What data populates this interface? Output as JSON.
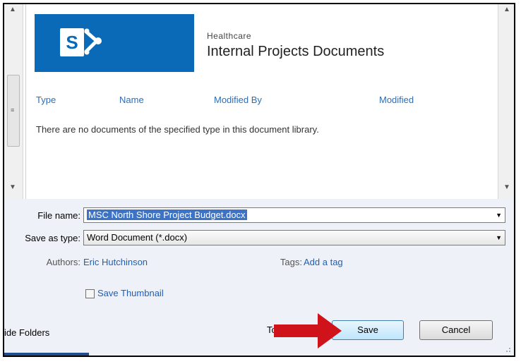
{
  "site": {
    "subtitle": "Healthcare",
    "title": "Internal Projects Documents",
    "logo_letter": "S"
  },
  "library": {
    "columns": [
      "Type",
      "Name",
      "Modified By",
      "Modified"
    ],
    "empty_message": "There are no documents of the specified type in this document library."
  },
  "form": {
    "file_name_label": "File name:",
    "file_name_value": "MSC North Shore Project Budget.docx",
    "save_type_label": "Save as type:",
    "save_type_value": "Word Document (*.docx)",
    "authors_label": "Authors:",
    "authors_value": "Eric Hutchinson",
    "tags_label": "Tags:",
    "tags_value": "Add a tag",
    "thumbnail_label": "Save Thumbnail",
    "thumbnail_checked": false
  },
  "footer": {
    "hide_folders_label": "ide Folders",
    "tools_label": "To",
    "save_label": "Save",
    "cancel_label": "Cancel"
  },
  "colors": {
    "sharepoint_blue": "#0a6ab7",
    "link_blue": "#1e5fb8",
    "annotation_arrow": "#d0121b"
  },
  "icons": {
    "annotation": "red-arrow-pointing-right"
  }
}
